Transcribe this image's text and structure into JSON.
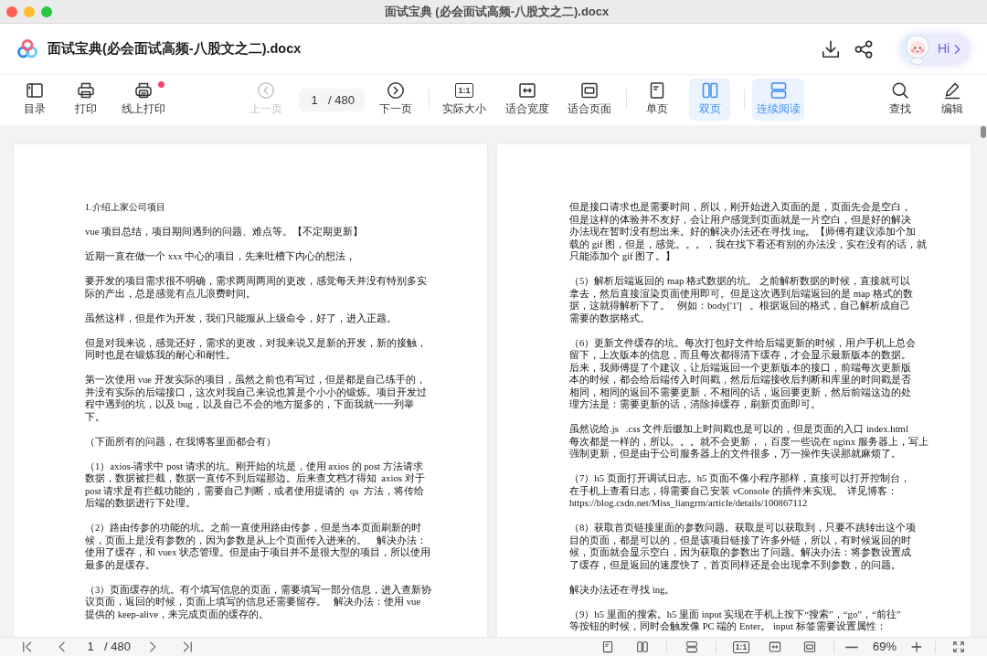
{
  "window": {
    "title": "面试宝典 (必会面试高频-八股文之二).docx"
  },
  "header": {
    "file_name": "面试宝典(必会面试高频-八股文之二).docx",
    "assistant_label": "Hi"
  },
  "toolbar": {
    "left": [
      {
        "label": "目录",
        "notification": false
      },
      {
        "label": "打印",
        "notification": false
      },
      {
        "label": "线上打印",
        "notification": true
      }
    ],
    "navigation": {
      "previous": {
        "label": "上一页",
        "disabled": true
      },
      "page_field": {
        "value": "1",
        "total": "/ 480"
      },
      "next": {
        "label": "下一页",
        "disabled": false
      }
    },
    "fit": [
      {
        "label": "实际大小",
        "icon_text": "1:1"
      },
      {
        "label": "适合宽度"
      },
      {
        "label": "适合页面"
      }
    ],
    "page_mode": [
      {
        "label": "单页",
        "selected": false
      },
      {
        "label": "双页",
        "selected": true
      }
    ],
    "continuous": {
      "label": "连续阅读",
      "selected": true
    },
    "right": [
      {
        "label": "查找"
      },
      {
        "label": "编辑"
      }
    ]
  },
  "document": {
    "pages": [
      {
        "paragraphs": [
          {
            "kind": "heading",
            "lines": [
              "1.介绍上家公司项目"
            ]
          },
          {
            "kind": "body",
            "lines": [
              "vue 项目总结，项目期间遇到的问题、难点等。【不定期更新】"
            ]
          },
          {
            "kind": "body",
            "lines": [
              "近期一直在做一个 xxx 中心的项目，先来吐槽下内心的想法，"
            ]
          },
          {
            "kind": "body",
            "lines": [
              "要开发的项目需求很不明确，需求两周两周的更改，感觉每天并没有特别多实",
              "际的产出，总是感觉有点儿浪费时间。"
            ]
          },
          {
            "kind": "body",
            "lines": [
              "虽然这样，但是作为开发，我们只能服从上级命令，好了，进入正题。"
            ]
          },
          {
            "kind": "body",
            "lines": [
              "但是对我来说，感觉还好，需求的更改，对我来说又是新的开发，新的接触，",
              "同时也是在锻炼我的耐心和耐性。"
            ]
          },
          {
            "kind": "body",
            "lines": [
              "第一次使用 vue 开发实际的项目，虽然之前也有写过，但是都是自己练手的，",
              "并没有实际的后端接口，这次对我自己来说也算是个小小的锻炼。项目开发过",
              "程中遇到的坑，以及 bug，以及自己不会的地方挺多的，下面我就一一列举",
              "下。"
            ]
          },
          {
            "kind": "body",
            "lines": [
              "（下面所有的问题，在我博客里面都会有）"
            ]
          },
          {
            "kind": "body",
            "lines": [
              "（1）axios-请求中 post 请求的坑。刚开始的坑是，使用 axios 的 post 方法请求",
              "数据，数据被拦截，数据一直传不到后端那边。后来查文档才得知  axios 对于",
              "post 请求是有拦截功能的，需要自己判断，或者使用提请的  qs  方法，将传给",
              "后端的数据进行下处理。"
            ]
          },
          {
            "kind": "body",
            "lines": [
              "（2）路由传参的功能的坑。之前一直使用路由传参，但是当本页面刷新的时",
              "候，页面上是没有参数的，因为参数是从上个页面传入进来的。    解决办法：",
              "使用了缓存，和 vuex 状态管理。但是由于项目并不是很大型的项目，所以使用",
              "最多的是缓存。"
            ]
          },
          {
            "kind": "body",
            "lines": [
              "（3）页面缓存的坑。有个填写信息的页面，需要填写一部分信息，进入查新协",
              "议页面，返回的时候，页面上填写的信息还需要留存。   解决办法：使用 vue",
              "提供的 keep-alive，来完成页面的缓存的。"
            ]
          }
        ]
      },
      {
        "paragraphs": [
          {
            "kind": "body",
            "lines": [
              "但是接口请求也是需要时间，所以，刚开始进入页面的是，页面先会是空白，",
              "但是这样的体验并不友好，会让用户感觉到页面就是一片空白，但是好的解决",
              "办法现在暂时没有想出来。好的解决办法还在寻找 ing。【师傅有建议添加个加",
              "载的 gif 图，但是，感觉。。。，我在找下看还有别的办法没，实在没有的话，就",
              "只能添加个 gif 图了。】"
            ]
          },
          {
            "kind": "body",
            "lines": [
              "（5）解析后端返回的 map 格式数据的坑。 之前解析数据的时候，直接就可以",
              "拿去，然后直接渲染页面使用即可。但是这次遇到后端返回的是 map 格式的数",
              "据，这就得解析下了。   例如：body['1']   。根据返回的格式，自己解析成自己",
              "需要的数据格式。"
            ]
          },
          {
            "kind": "body",
            "lines": [
              "（6）更新文件缓存的坑。每次打包好文件给后端更新的时候，用户手机上总会",
              "留下，上次版本的信息，而且每次都得清下缓存，才会显示最新版本的数据。",
              "后来，我师傅提了个建议，让后端返回一个更新版本的接口，前端每次更新版",
              "本的时候，都会给后端传入时间戳，然后后端接收后判断和库里的时间戳是否",
              "相同，相同的返回不需要更新，不相同的话，返回要更新，然后前端这边的处",
              "理方法是：需要更新的话，清除掉缓存，刷新页面即可。"
            ]
          },
          {
            "kind": "body",
            "lines": [
              "虽然说给.js   .css 文件后缀加上时间戳也是可以的，但是页面的入口 index.html",
              "每次都是一样的，所以。。。就不会更新，，百度一些说在 nginx 服务器上，写上",
              "强制更新，但是由于公司服务器上的文件很多，万一操作失误那就麻烦了。"
            ]
          },
          {
            "kind": "body",
            "lines": [
              "（7）h5 页面打开调试日志。h5 页面不像小程序那样，直接可以打开控制台，",
              "在手机上查看日志，得需要自己安装 vConsole 的插件来实现。  详见博客：",
              "https://blog.csdn.net/Miss_liangrm/article/details/100867112"
            ]
          },
          {
            "kind": "body",
            "lines": [
              "（8）获取首页链接里面的参数问题。获取是可以获取到，只要不跳转出这个项",
              "目的页面，都是可以的，但是该项目链接了许多外链，所以，有时候返回的时",
              "候，页面就会显示空白，因为获取的参数出了问题。解决办法：将参数设置成",
              "了缓存，但是返回的速度快了，首页同样还是会出现拿不到参数，的问题。"
            ]
          },
          {
            "kind": "body",
            "lines": [
              "解决办法还在寻找 ing。"
            ]
          },
          {
            "kind": "body",
            "lines": [
              "（9）h5 里面的搜索。h5 里面 input 实现在手机上按下“搜索”，“go”，“前往”",
              "等按钮的时候，同时会触发像 PC 端的 Enter。 input 标签需要设置属性："
            ]
          }
        ]
      }
    ]
  },
  "bottom_bar": {
    "page_field": {
      "value": "1",
      "total": "/ 480"
    },
    "ratio_icon_text": "1:1",
    "zoom_level": "69%"
  }
}
